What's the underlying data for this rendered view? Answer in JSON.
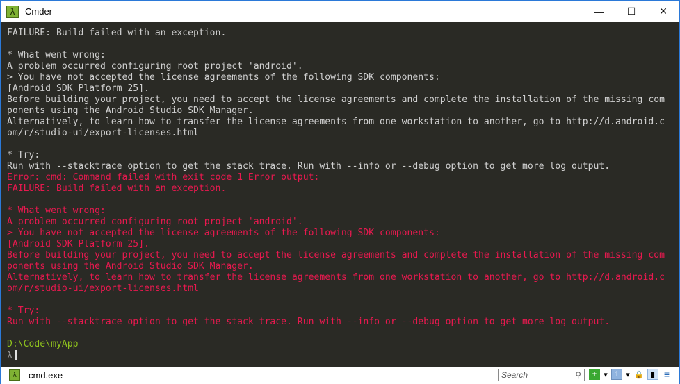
{
  "window": {
    "title": "Cmder",
    "app_icon": "λ",
    "minimize": "—",
    "maximize": "☐",
    "close": "✕"
  },
  "terminal": {
    "lines": [
      {
        "text": "FAILURE: Build failed with an exception.",
        "kind": "normal"
      },
      {
        "text": "",
        "kind": "normal"
      },
      {
        "text": "* What went wrong:",
        "kind": "normal"
      },
      {
        "text": "A problem occurred configuring root project 'android'.",
        "kind": "normal"
      },
      {
        "text": "> You have not accepted the license agreements of the following SDK components:",
        "kind": "normal"
      },
      {
        "text": "[Android SDK Platform 25].",
        "kind": "normal"
      },
      {
        "text": "Before building your project, you need to accept the license agreements and complete the installation of the missing com",
        "kind": "normal"
      },
      {
        "text": "ponents using the Android Studio SDK Manager.",
        "kind": "normal"
      },
      {
        "text": "Alternatively, to learn how to transfer the license agreements from one workstation to another, go to http://d.android.c",
        "kind": "normal"
      },
      {
        "text": "om/r/studio-ui/export-licenses.html",
        "kind": "normal"
      },
      {
        "text": "",
        "kind": "normal"
      },
      {
        "text": "* Try:",
        "kind": "normal"
      },
      {
        "text": "Run with --stacktrace option to get the stack trace. Run with --info or --debug option to get more log output.",
        "kind": "normal"
      },
      {
        "text": "Error: cmd: Command failed with exit code 1 Error output:",
        "kind": "err"
      },
      {
        "text": "FAILURE: Build failed with an exception.",
        "kind": "err"
      },
      {
        "text": "",
        "kind": "err"
      },
      {
        "text": "* What went wrong:",
        "kind": "err"
      },
      {
        "text": "A problem occurred configuring root project 'android'.",
        "kind": "err"
      },
      {
        "text": "> You have not accepted the license agreements of the following SDK components:",
        "kind": "err"
      },
      {
        "text": "[Android SDK Platform 25].",
        "kind": "err"
      },
      {
        "text": "Before building your project, you need to accept the license agreements and complete the installation of the missing com",
        "kind": "err"
      },
      {
        "text": "ponents using the Android Studio SDK Manager.",
        "kind": "err"
      },
      {
        "text": "Alternatively, to learn how to transfer the license agreements from one workstation to another, go to http://d.android.c",
        "kind": "err"
      },
      {
        "text": "om/r/studio-ui/export-licenses.html",
        "kind": "err"
      },
      {
        "text": "",
        "kind": "err"
      },
      {
        "text": "* Try:",
        "kind": "err"
      },
      {
        "text": "Run with --stacktrace option to get the stack trace. Run with --info or --debug option to get more log output.",
        "kind": "err"
      },
      {
        "text": "",
        "kind": "normal"
      },
      {
        "text": "D:\\Code\\myApp",
        "kind": "path"
      }
    ],
    "prompt": "λ"
  },
  "statusbar": {
    "tab_label": "cmd.exe",
    "search_placeholder": "Search",
    "icons": [
      "search-icon",
      "new-console-icon",
      "dropdown-icon",
      "console-number-icon",
      "dropdown-icon",
      "lock-icon",
      "split-view-icon",
      "menu-icon"
    ]
  },
  "colors": {
    "error": "#e8194f",
    "path": "#8fc21d",
    "app": "#7fb233"
  }
}
